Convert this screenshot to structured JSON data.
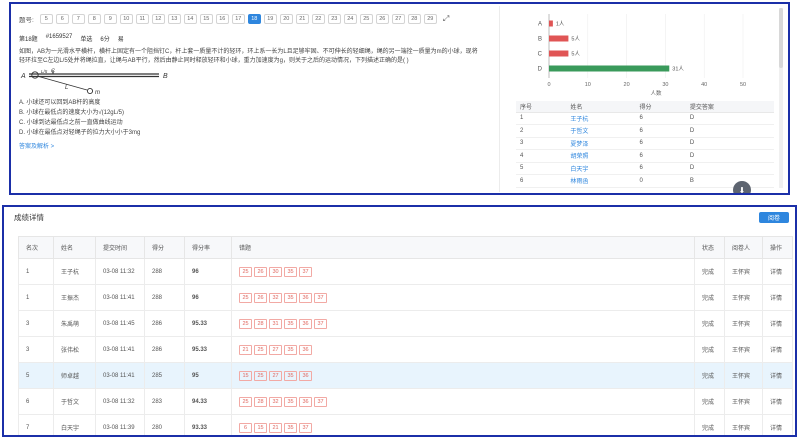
{
  "question_nav": {
    "label": "题号:",
    "numbers": [
      "5",
      "6",
      "7",
      "8",
      "9",
      "10",
      "11",
      "12",
      "13",
      "14",
      "15",
      "16",
      "17",
      "18",
      "19",
      "20",
      "21",
      "22",
      "23",
      "24",
      "25",
      "26",
      "27",
      "28",
      "29"
    ],
    "active": "18"
  },
  "question": {
    "number": "第18题",
    "id": "#1659527",
    "type": "单选",
    "score": "6分",
    "difficulty": "易",
    "text": "如图，AB为一光滑水平横杆，横杆上固定有一个阻挡钉C，杆上套一质量不计的轻环，环上系一长为L且足够牢固、不可伸长的轻细绳，绳的另一端拴一质量为m的小球，现将轻环拉至C左边L/5处并将绳拉直，让绳与AB平行，然后由静止同时释放轻环和小球，重力加速度为g，则关于之后的运动情况，下列描述正确的是(    )",
    "figure_labels": {
      "A": "A",
      "B": "B",
      "C": "C",
      "L5": "L/5",
      "L": "L",
      "m": "m"
    },
    "options": [
      "A. 小球还可以回到AB杆的高度",
      "B. 小球在最低点的速度大小为√(12gL/5)",
      "C. 小球到达最低点之前一直做曲线运动",
      "D. 小球在最低点对轻绳子的拉力大小小于3mg"
    ],
    "answer_link": "答案及解析 >"
  },
  "chart_data": {
    "type": "bar",
    "orientation": "horizontal",
    "categories": [
      "A",
      "B",
      "C",
      "D"
    ],
    "values": [
      1,
      5,
      5,
      31
    ],
    "value_labels": [
      "1人",
      "5人",
      "5人",
      "31人"
    ],
    "colors": [
      "#e05555",
      "#e05555",
      "#e05555",
      "#3a9a5b"
    ],
    "xlim": [
      0,
      50
    ],
    "xticks": [
      "0",
      "10",
      "20",
      "30",
      "40",
      "50"
    ],
    "xlabel": "人数"
  },
  "stats_table": {
    "headers": [
      "序号",
      "姓名",
      "得分",
      "提交答案"
    ],
    "rows": [
      [
        "1",
        "王子杭",
        "6",
        "D"
      ],
      [
        "2",
        "于哲文",
        "6",
        "D"
      ],
      [
        "3",
        "夏梦泽",
        "6",
        "D"
      ],
      [
        "4",
        "胡荣照",
        "6",
        "D"
      ],
      [
        "5",
        "白天宇",
        "6",
        "D"
      ],
      [
        "6",
        "林雨函",
        "0",
        "B"
      ]
    ]
  },
  "grades": {
    "title": "成绩详情",
    "review_button": "阅卷",
    "headers": [
      "名次",
      "姓名",
      "提交时间",
      "得分",
      "得分率",
      "错题",
      "状态",
      "阅卷人",
      "操作"
    ],
    "rows": [
      {
        "rank": "1",
        "name": "王子杭",
        "time": "03-08 11:32",
        "score": "288",
        "rate": "96",
        "wrong": [
          "25",
          "26",
          "30",
          "35",
          "37"
        ],
        "status": "完成",
        "reviewer": "王怀宾",
        "action": "详情"
      },
      {
        "rank": "1",
        "name": "王振杰",
        "time": "03-08 11:41",
        "score": "288",
        "rate": "96",
        "wrong": [
          "25",
          "26",
          "32",
          "35",
          "36",
          "37"
        ],
        "status": "完成",
        "reviewer": "王怀宾",
        "action": "详情"
      },
      {
        "rank": "3",
        "name": "朱禹萌",
        "time": "03-08 11:45",
        "score": "286",
        "rate": "95.33",
        "wrong": [
          "25",
          "28",
          "31",
          "35",
          "36",
          "37"
        ],
        "status": "完成",
        "reviewer": "王怀宾",
        "action": "详情"
      },
      {
        "rank": "3",
        "name": "张伟松",
        "time": "03-08 11:41",
        "score": "286",
        "rate": "95.33",
        "wrong": [
          "21",
          "25",
          "27",
          "35",
          "36"
        ],
        "status": "完成",
        "reviewer": "王怀宾",
        "action": "详情"
      },
      {
        "rank": "5",
        "name": "师卓越",
        "time": "03-08 11:41",
        "score": "285",
        "rate": "95",
        "wrong": [
          "15",
          "25",
          "27",
          "35",
          "36"
        ],
        "status": "完成",
        "reviewer": "王怀宾",
        "action": "详情"
      },
      {
        "rank": "6",
        "name": "于哲文",
        "time": "03-08 11:32",
        "score": "283",
        "rate": "94.33",
        "wrong": [
          "25",
          "28",
          "32",
          "35",
          "36",
          "37"
        ],
        "status": "完成",
        "reviewer": "王怀宾",
        "action": "详情"
      },
      {
        "rank": "7",
        "name": "白天宇",
        "time": "03-08 11:39",
        "score": "280",
        "rate": "93.33",
        "wrong": [
          "6",
          "15",
          "21",
          "35",
          "37"
        ],
        "status": "完成",
        "reviewer": "王怀宾",
        "action": "详情"
      }
    ],
    "highlighted_row": 4
  },
  "colors": {
    "accent": "#2e86de",
    "frame": "#1b2fa8",
    "correct_bar": "#3a9a5b",
    "wrong_bar": "#e05555",
    "rate_text": "#2a9d5a",
    "tag_border": "#f2a9a4"
  }
}
